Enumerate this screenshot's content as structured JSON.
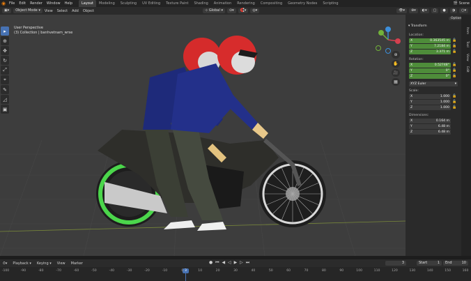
{
  "topbar": {
    "menus": [
      "File",
      "Edit",
      "Render",
      "Window",
      "Help"
    ],
    "workspaces": [
      "Layout",
      "Modeling",
      "Sculpting",
      "UV Editing",
      "Texture Paint",
      "Shading",
      "Animation",
      "Rendering",
      "Compositing",
      "Geometry Nodes",
      "Scripting"
    ],
    "active_workspace": "Layout",
    "scene": "Scene"
  },
  "header": {
    "mode": "Object Mode",
    "menus": [
      "View",
      "Select",
      "Add",
      "Object"
    ],
    "orientation": "Global",
    "options": "Options"
  },
  "viewport": {
    "perspective": "User Perspective",
    "collection": "(3) Collection | banhvetnam_wrse"
  },
  "npanel": {
    "title": "Transform",
    "location_label": "Location:",
    "location": [
      {
        "axis": "X",
        "value": "0.363545 m"
      },
      {
        "axis": "Y",
        "value": "7.2184 m"
      },
      {
        "axis": "Z",
        "value": "3.371 m"
      }
    ],
    "rotation_label": "Rotation:",
    "rotation": [
      {
        "axis": "X",
        "value": "0.52748°"
      },
      {
        "axis": "Y",
        "value": "0°"
      },
      {
        "axis": "Z",
        "value": "0°"
      }
    ],
    "rotation_mode": "XYZ Euler",
    "scale_label": "Scale:",
    "scale": [
      {
        "axis": "X",
        "value": "1.000"
      },
      {
        "axis": "Y",
        "value": "1.000"
      },
      {
        "axis": "Z",
        "value": "1.000"
      }
    ],
    "dimensions_label": "Dimensions:",
    "dimensions": [
      {
        "axis": "X",
        "value": "0.164 m"
      },
      {
        "axis": "Y",
        "value": "6.48 m"
      },
      {
        "axis": "Z",
        "value": "6.48 m"
      }
    ],
    "tabs": [
      "Item",
      "Tool",
      "View",
      "Edit"
    ]
  },
  "timeline": {
    "menus": [
      "Playback",
      "Keying",
      "View",
      "Marker"
    ],
    "current_frame": "3",
    "start_label": "Start",
    "start": "1",
    "end_label": "End",
    "end": "10",
    "ruler_ticks": [
      "-100",
      "-90",
      "-80",
      "-70",
      "-60",
      "-50",
      "-40",
      "-30",
      "-20",
      "-10",
      "0",
      "10",
      "20",
      "30",
      "40",
      "50",
      "60",
      "70",
      "80",
      "90",
      "100",
      "110",
      "120",
      "130",
      "140",
      "150",
      "160"
    ],
    "playhead": "3"
  }
}
